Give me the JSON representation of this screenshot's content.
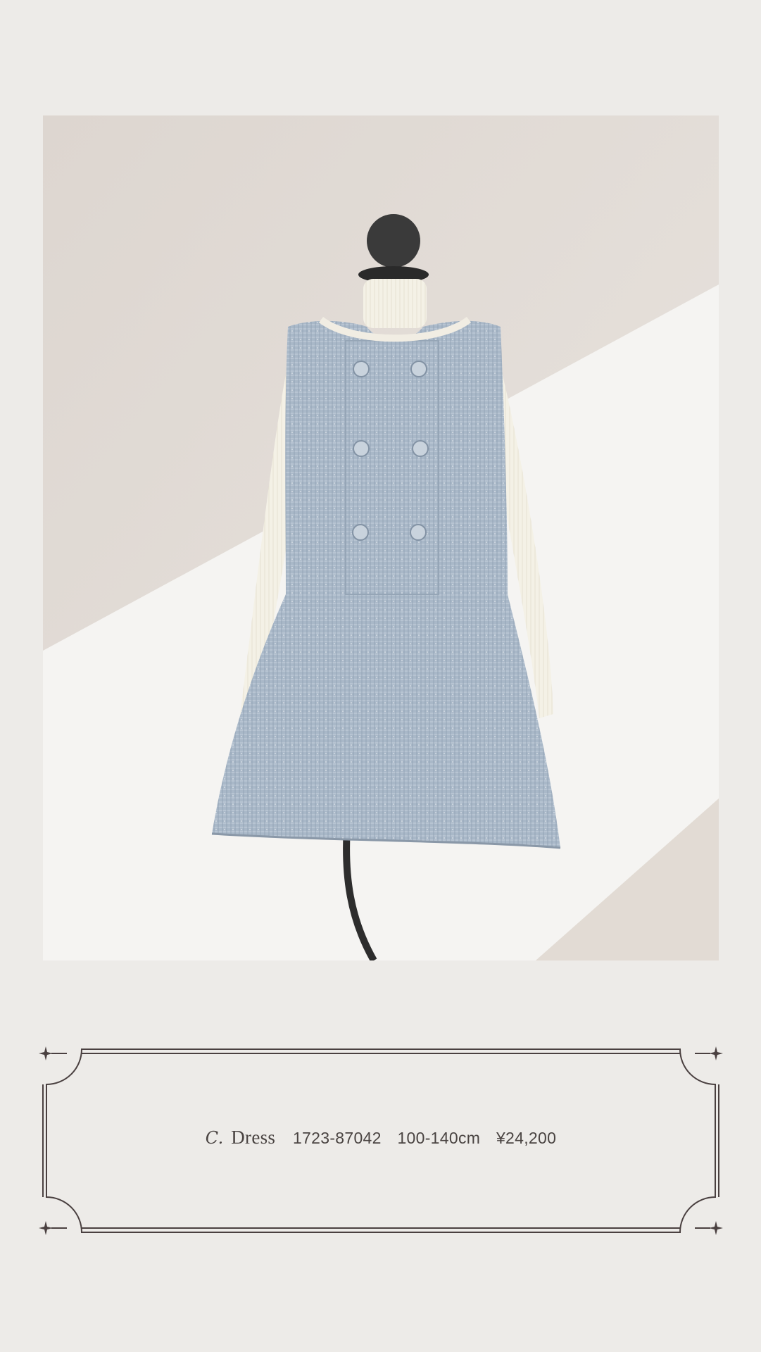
{
  "product": {
    "letter": "C.",
    "name": "Dress",
    "code": "1723-87042",
    "size": "100-140cm",
    "price": "¥24,200"
  },
  "colors": {
    "background": "#edebe8",
    "frame_line": "#4a4040",
    "dress": "#a9b8c8",
    "turtleneck": "#f4f1e6",
    "mannequin": "#2d2d2d"
  },
  "icons": [
    "sparkle-icon",
    "sparkle-icon",
    "sparkle-icon",
    "sparkle-icon"
  ]
}
